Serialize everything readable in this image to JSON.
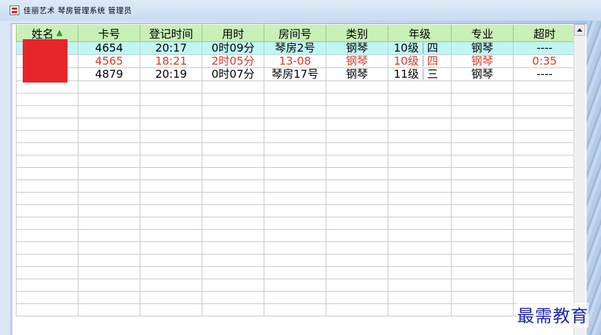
{
  "window": {
    "title": "佳丽艺术 琴房管理系统 管理员"
  },
  "grid": {
    "columns": [
      "姓名",
      "卡号",
      "登记时间",
      "用时",
      "房间号",
      "类别",
      "年级",
      "专业",
      "超时"
    ],
    "sort_column": "姓名",
    "sort_icon": "sort-ascending-arrow-icon",
    "rows": [
      {
        "name": "",
        "card": "4654",
        "checkin": "20:17",
        "duration": "0时09分",
        "room": "琴房2号",
        "category": "钢琴",
        "grade": "10级",
        "class": "四",
        "major": "钢琴",
        "overtime": "----",
        "state": "selected"
      },
      {
        "name": "",
        "card": "4565",
        "checkin": "18:21",
        "duration": "2时05分",
        "room": "13-08",
        "category": "钢琴",
        "grade": "10级",
        "class": "四",
        "major": "钢琴",
        "overtime": "0:35",
        "state": "overtime"
      },
      {
        "name": "",
        "card": "4879",
        "checkin": "20:19",
        "duration": "0时07分",
        "room": "琴房17号",
        "category": "钢琴",
        "grade": "11级",
        "class": "三",
        "major": "钢琴",
        "overtime": "----",
        "state": "normal"
      }
    ],
    "empty_rows": 19
  },
  "colors": {
    "header_bg": "#c9f0b6",
    "selected_row_bg": "#bff6f4",
    "overtime_text": "#d9382a",
    "redaction": "#e8242b"
  },
  "watermark": "最需教育"
}
